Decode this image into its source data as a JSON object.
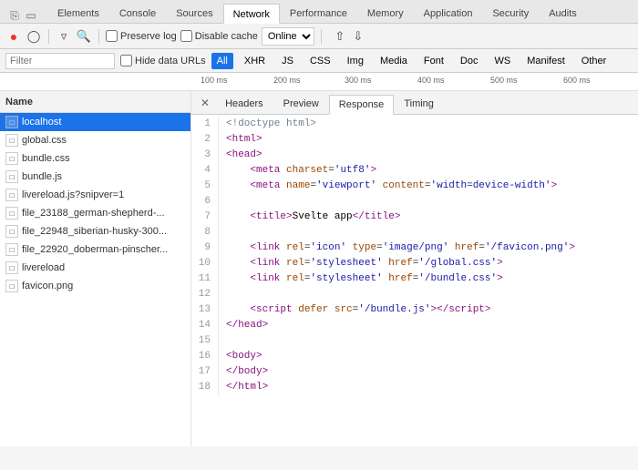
{
  "tabs": {
    "items": [
      {
        "label": "Elements",
        "active": false
      },
      {
        "label": "Console",
        "active": false
      },
      {
        "label": "Sources",
        "active": false
      },
      {
        "label": "Network",
        "active": true
      },
      {
        "label": "Performance",
        "active": false
      },
      {
        "label": "Memory",
        "active": false
      },
      {
        "label": "Application",
        "active": false
      },
      {
        "label": "Security",
        "active": false
      },
      {
        "label": "Audits",
        "active": false
      }
    ]
  },
  "toolbar": {
    "preserve_log_label": "Preserve log",
    "disable_cache_label": "Disable cache",
    "online_label": "Online"
  },
  "filter": {
    "placeholder": "Filter",
    "hide_data_urls_label": "Hide data URLs",
    "types": [
      "All",
      "XHR",
      "JS",
      "CSS",
      "Img",
      "Media",
      "Font",
      "Doc",
      "WS",
      "Manifest",
      "Other"
    ]
  },
  "timeline": {
    "ticks": [
      "100 ms",
      "200 ms",
      "300 ms",
      "400 ms",
      "500 ms",
      "600 ms"
    ]
  },
  "file_list": {
    "header": "Name",
    "items": [
      {
        "name": "localhost",
        "selected": true
      },
      {
        "name": "global.css",
        "selected": false
      },
      {
        "name": "bundle.css",
        "selected": false
      },
      {
        "name": "bundle.js",
        "selected": false
      },
      {
        "name": "livereload.js?snipver=1",
        "selected": false
      },
      {
        "name": "file_23188_german-shepherd-...",
        "selected": false
      },
      {
        "name": "file_22948_siberian-husky-300...",
        "selected": false
      },
      {
        "name": "file_22920_doberman-pinscher...",
        "selected": false
      },
      {
        "name": "livereload",
        "selected": false
      },
      {
        "name": "favicon.png",
        "selected": false
      }
    ]
  },
  "inner_tabs": {
    "items": [
      "Headers",
      "Preview",
      "Response",
      "Timing"
    ],
    "active": "Response"
  },
  "code": {
    "lines": [
      {
        "num": 1,
        "html": "<span class='comment'>&lt;!doctype html&gt;</span>"
      },
      {
        "num": 2,
        "html": "<span class='tag'>&lt;html&gt;</span>"
      },
      {
        "num": 3,
        "html": "<span class='tag'>&lt;head&gt;</span>"
      },
      {
        "num": 4,
        "html": "    <span class='tag'>&lt;meta</span> <span class='attr'>charset</span>=<span class='val'>'utf8'</span><span class='tag'>&gt;</span>"
      },
      {
        "num": 5,
        "html": "    <span class='tag'>&lt;meta</span> <span class='attr'>name</span>=<span class='val'>'viewport'</span> <span class='attr'>content</span>=<span class='val'>'width=device-width'</span><span class='tag'>&gt;</span>"
      },
      {
        "num": 6,
        "html": ""
      },
      {
        "num": 7,
        "html": "    <span class='tag'>&lt;title&gt;</span><span class='text'>Svelte app</span><span class='tag'>&lt;/title&gt;</span>"
      },
      {
        "num": 8,
        "html": ""
      },
      {
        "num": 9,
        "html": "    <span class='tag'>&lt;link</span> <span class='attr'>rel</span>=<span class='val'>'icon'</span> <span class='attr'>type</span>=<span class='val'>'image/png'</span> <span class='attr'>href</span>=<span class='val'>'/favicon.png'</span><span class='tag'>&gt;</span>"
      },
      {
        "num": 10,
        "html": "    <span class='tag'>&lt;link</span> <span class='attr'>rel</span>=<span class='val'>'stylesheet'</span> <span class='attr'>href</span>=<span class='val'>'/global.css'</span><span class='tag'>&gt;</span>"
      },
      {
        "num": 11,
        "html": "    <span class='tag'>&lt;link</span> <span class='attr'>rel</span>=<span class='val'>'stylesheet'</span> <span class='attr'>href</span>=<span class='val'>'/bundle.css'</span><span class='tag'>&gt;</span>"
      },
      {
        "num": 12,
        "html": ""
      },
      {
        "num": 13,
        "html": "    <span class='tag'>&lt;script</span> <span class='attr'>defer</span> <span class='attr'>src</span>=<span class='val'>'/bundle.js'</span><span class='tag'>&gt;&lt;/script&gt;</span>"
      },
      {
        "num": 14,
        "html": "<span class='tag'>&lt;/head&gt;</span>"
      },
      {
        "num": 15,
        "html": ""
      },
      {
        "num": 16,
        "html": "<span class='tag'>&lt;body&gt;</span>"
      },
      {
        "num": 17,
        "html": "<span class='tag'>&lt;/body&gt;</span>"
      },
      {
        "num": 18,
        "html": "<span class='tag'>&lt;/html&gt;</span>"
      }
    ]
  },
  "colors": {
    "active_tab_bg": "#fff",
    "toolbar_bg": "#f3f3f3",
    "selected_item": "#1a73e8"
  }
}
